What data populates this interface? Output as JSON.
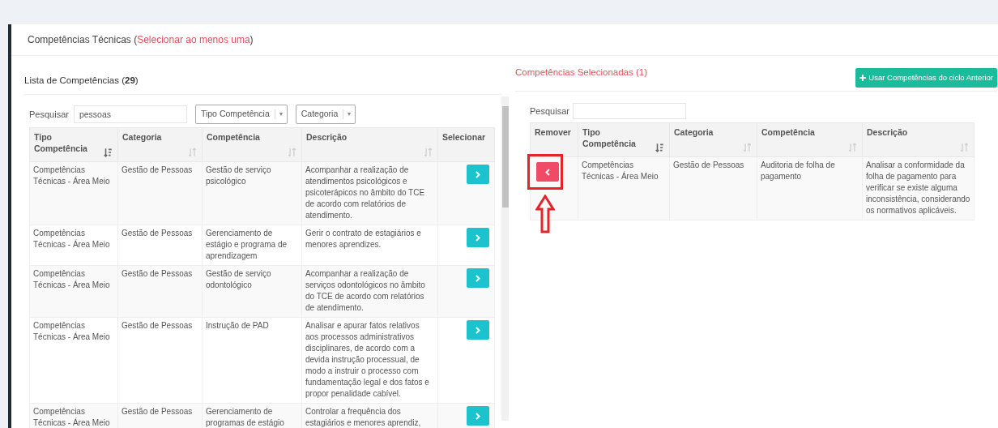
{
  "section": {
    "title_start": "Competências Técnicas (",
    "requirement": "Selecionar ao menos uma",
    "title_end": ")"
  },
  "available": {
    "title": "Lista de Competências (**29**)",
    "search_label": "Pesquisar",
    "search_value": "pessoas",
    "filters": [
      {
        "label": "Tipo Competência",
        "caret": "▾"
      },
      {
        "label": "Categoria",
        "caret": "▾"
      }
    ],
    "columns": [
      {
        "label": "Tipo Competência",
        "sortable": true,
        "sorted": true
      },
      {
        "label": "Categoria",
        "sortable": true,
        "sorted": false
      },
      {
        "label": "Competência",
        "sortable": true,
        "sorted": false
      },
      {
        "label": "Descrição",
        "sortable": true,
        "sorted": false
      },
      {
        "label": "Selecionar",
        "sortable": false
      }
    ],
    "rows": [
      {
        "type": "Competências Técnicas - Área Meio",
        "category": "Gestão de Pessoas",
        "competency": "Gestão de serviço psicológico",
        "description": "Acompanhar a realização de atendimentos psicológicos e psicoterápicos no âmbito do TCE de acordo com relatórios de atendimento."
      },
      {
        "type": "Competências Técnicas - Área Meio",
        "category": "Gestão de Pessoas",
        "competency": "Gerenciamento de estágio e programa de aprendizagem",
        "description": "Gerir o contrato de estagiários e menores aprendizes."
      },
      {
        "type": "Competências Técnicas - Área Meio",
        "category": "Gestão de Pessoas",
        "competency": "Gestão de serviço odontológico",
        "description": "Acompanhar a realização de serviços odontológicos no âmbito do TCE de acordo com relatórios de atendimento."
      },
      {
        "type": "Competências Técnicas - Área Meio",
        "category": "Gestão de Pessoas",
        "competency": "Instrução de PAD",
        "description": "Analisar e apurar fatos relativos aos processos administrativos disciplinares, de acordo com a devida instrução processual, de modo a instruir o processo com fundamentação legal e dos fatos e propor penalidade cabível."
      },
      {
        "type": "Competências Técnicas - Área Meio",
        "category": "Gestão de Pessoas",
        "competency": "Gerenciamento de programas de estágio",
        "description": "Controlar a frequência dos estagiários e menores aprendiz,"
      }
    ]
  },
  "selected": {
    "title": "Competências Selecionadas (1)",
    "previous_cycle_button": "Usar Competências do ciclo Anterior",
    "search_label": "Pesquisar",
    "columns": [
      {
        "label": "Remover",
        "sortable": false
      },
      {
        "label": "Tipo Competência",
        "sortable": true,
        "sorted": true
      },
      {
        "label": "Categoria",
        "sortable": true,
        "sorted": false
      },
      {
        "label": "Competência",
        "sortable": true,
        "sorted": false
      },
      {
        "label": "Descrição",
        "sortable": true,
        "sorted": false
      }
    ],
    "rows": [
      {
        "type": "Competências Técnicas - Área Meio",
        "category": "Gestão de Pessoas",
        "competency": "Auditoria de folha de pagamento",
        "description": "Analisar a conformidade da folha de pagamento para verificar se existe alguma inconsistência, considerando os normativos aplicáveis.",
        "highlighted": true
      }
    ]
  }
}
